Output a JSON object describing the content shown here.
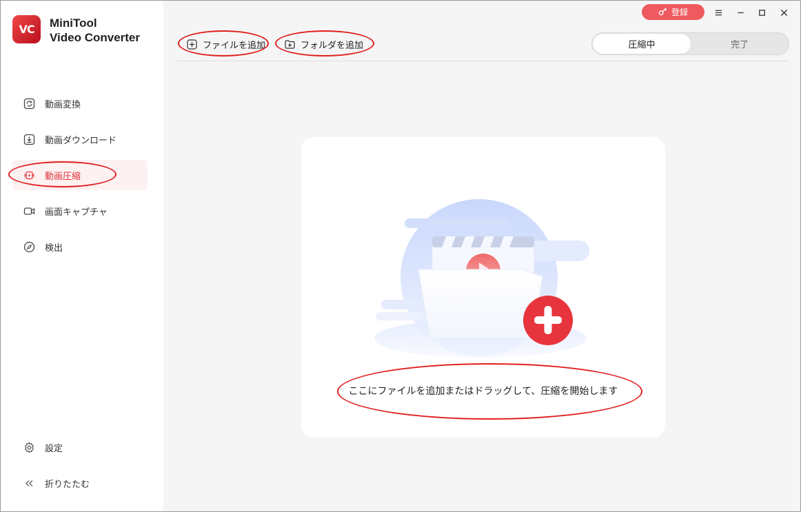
{
  "app": {
    "logo_text": "VC",
    "name_line1": "MiniTool",
    "name_line2": "Video Converter"
  },
  "sidebar": {
    "items": [
      {
        "label": "動画変換",
        "icon": "convert-icon"
      },
      {
        "label": "動画ダウンロード",
        "icon": "download-icon"
      },
      {
        "label": "動画圧縮",
        "icon": "compress-icon",
        "active": true
      },
      {
        "label": "画面キャプチャ",
        "icon": "camera-icon"
      },
      {
        "label": "検出",
        "icon": "compass-icon"
      }
    ],
    "bottom": [
      {
        "label": "設定",
        "icon": "gear-icon"
      },
      {
        "label": "折りたたむ",
        "icon": "collapse-icon"
      }
    ]
  },
  "header": {
    "register_label": "登録",
    "add_file_label": "ファイルを追加",
    "add_folder_label": "フォルダを追加",
    "tabs": [
      {
        "label": "圧縮中",
        "active": true
      },
      {
        "label": "完了",
        "active": false
      }
    ]
  },
  "main": {
    "drop_text": "ここにファイルを追加またはドラッグして、圧縮を開始します"
  },
  "colors": {
    "accent": "#e0333a",
    "register": "#ee5a60",
    "annotation": "#e11d1d"
  }
}
